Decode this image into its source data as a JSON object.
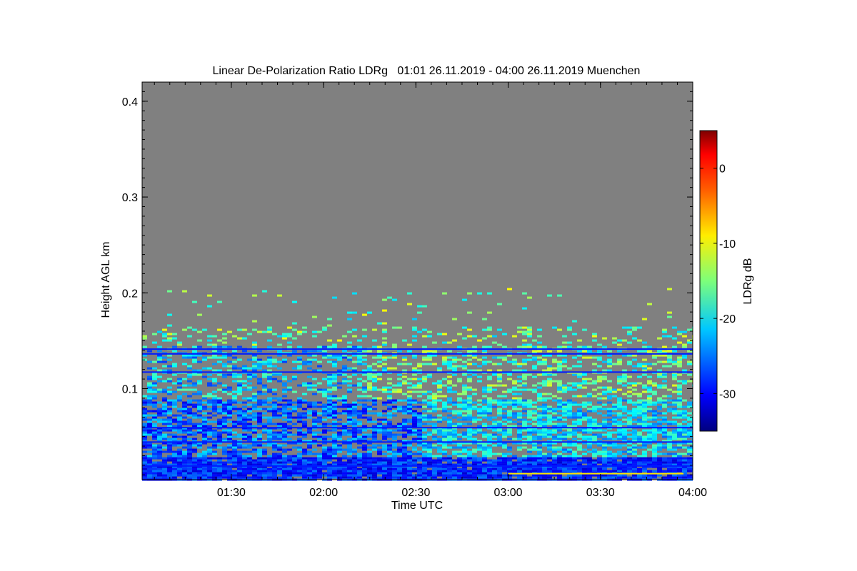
{
  "chart_data": {
    "type": "heatmap",
    "title": "Linear De-Polarization Ratio LDRg   01:01 26.11.2019 - 04:00 26.11.2019 Muenchen",
    "xlabel": "Time UTC",
    "ylabel": "Height AGL km",
    "x_ticks": [
      "01:30",
      "02:00",
      "02:30",
      "03:00",
      "03:30",
      "04:00"
    ],
    "x_tick_values_hours": [
      1.5,
      2.0,
      2.5,
      3.0,
      3.5,
      4.0
    ],
    "xlim_hours": [
      1.0167,
      4.0
    ],
    "y_ticks": [
      "0.1",
      "0.2",
      "0.3",
      "0.4"
    ],
    "y_tick_values": [
      0.1,
      0.2,
      0.3,
      0.4
    ],
    "ylim": [
      0.005,
      0.42
    ],
    "colorbar": {
      "label": "LDRg dB",
      "ticks": [
        "0",
        "-10",
        "-20",
        "-30"
      ],
      "tick_values": [
        0,
        -10,
        -20,
        -30
      ],
      "range": [
        -35,
        5
      ],
      "colormap": "jet"
    },
    "missing_color": "#808080",
    "description_layers": [
      {
        "height_range": [
          0.005,
          0.03
        ],
        "ldr_db_typical": -31
      },
      {
        "height_range": [
          0.03,
          0.09
        ],
        "ldr_db_typical": -28
      },
      {
        "height_range": [
          0.09,
          0.145
        ],
        "ldr_db_typical": -22
      },
      {
        "height_range": [
          0.145,
          0.2
        ],
        "ldr_db_typical": -18
      }
    ],
    "constant_lines_height": [
      0.142,
      0.137,
      0.118,
      0.06,
      0.045,
      0.02
    ]
  }
}
